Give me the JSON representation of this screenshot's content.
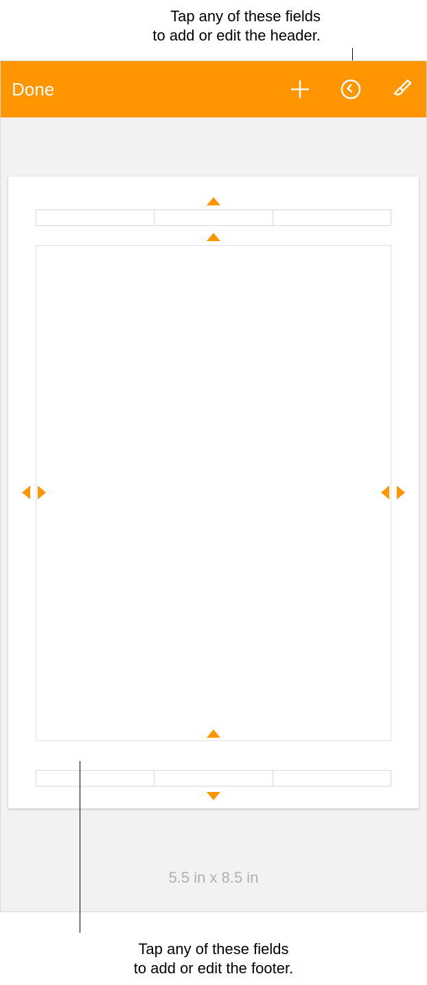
{
  "callouts": {
    "header_line1": "Tap any of these fields",
    "header_line2": "to add or edit the header.",
    "footer_line1": "Tap any of these fields",
    "footer_line2": "to add or edit the footer."
  },
  "toolbar": {
    "done_label": "Done",
    "icons": {
      "add": "plus-icon",
      "undo": "undo-icon",
      "format": "paintbrush-icon"
    }
  },
  "page": {
    "header_cells": [
      "",
      "",
      ""
    ],
    "footer_cells": [
      "",
      "",
      ""
    ],
    "dimensions_label": "5.5 in x 8.5 in"
  },
  "colors": {
    "accent": "#ff9500"
  }
}
